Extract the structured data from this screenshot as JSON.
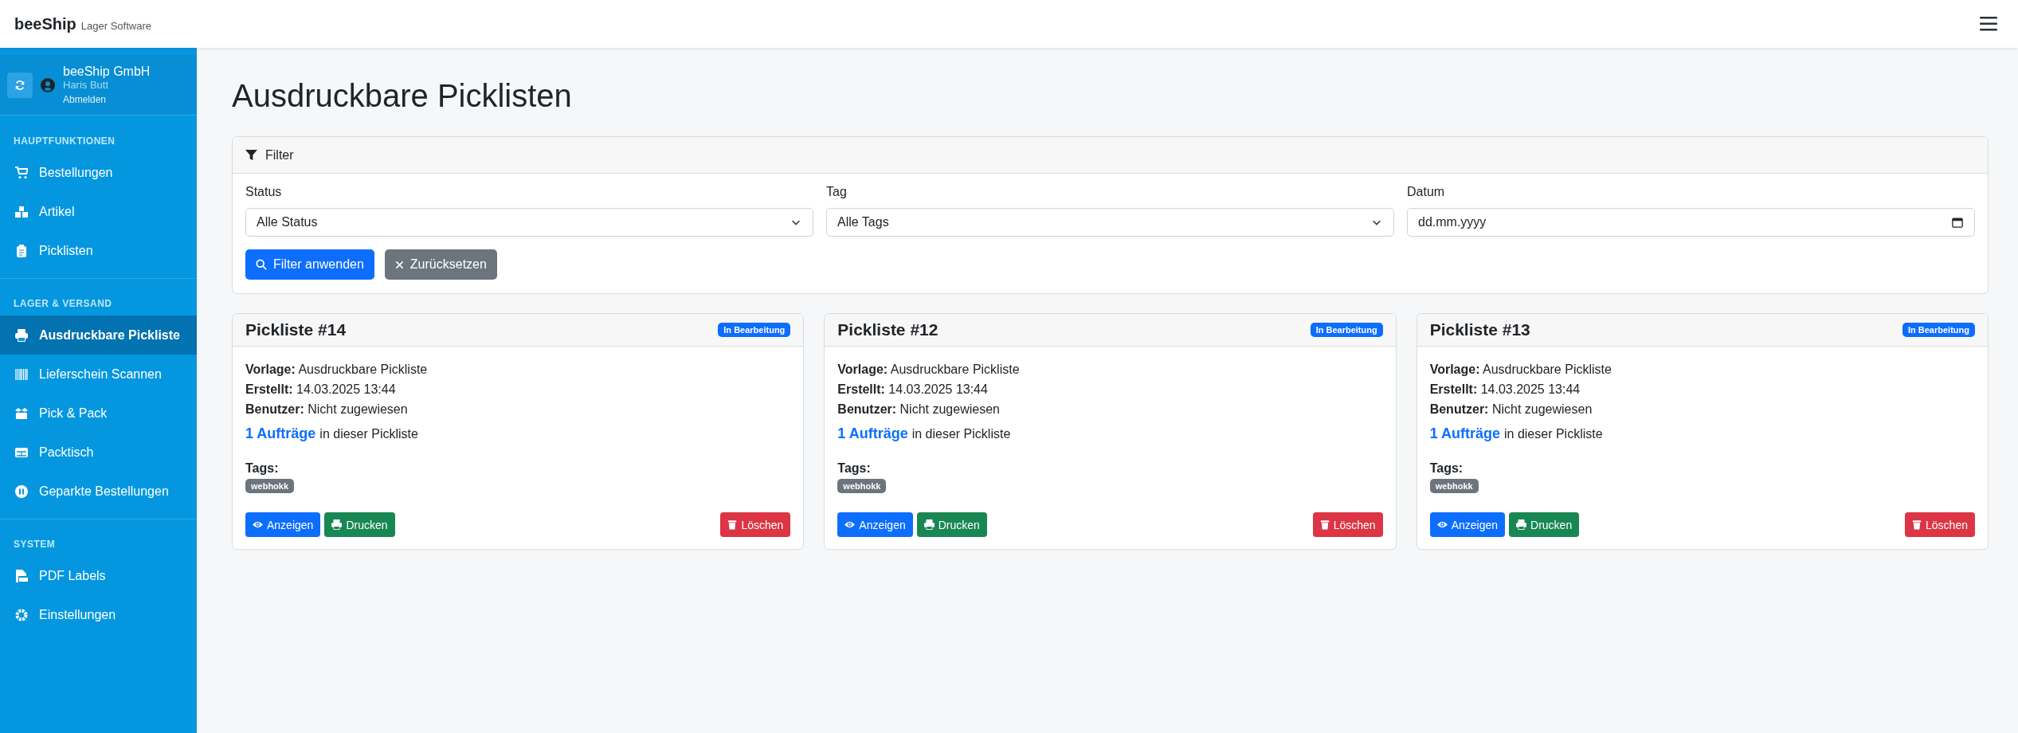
{
  "brand": {
    "name": "beeShip",
    "subtitle": "Lager Software"
  },
  "account": {
    "company": "beeShip GmbH",
    "user": "Haris Butt",
    "logout": "Abmelden"
  },
  "sidebar": {
    "sections": [
      {
        "title": "HAUPTFUNKTIONEN",
        "items": [
          {
            "label": "Bestellungen",
            "selected": false
          },
          {
            "label": "Artikel",
            "selected": false
          },
          {
            "label": "Picklisten",
            "selected": false
          }
        ]
      },
      {
        "title": "LAGER & VERSAND",
        "items": [
          {
            "label": "Ausdruckbare Pickliste",
            "selected": true
          },
          {
            "label": "Lieferschein Scannen",
            "selected": false
          },
          {
            "label": "Pick & Pack",
            "selected": false
          },
          {
            "label": "Packtisch",
            "selected": false
          },
          {
            "label": "Geparkte Bestellungen",
            "selected": false
          }
        ]
      },
      {
        "title": "SYSTEM",
        "items": [
          {
            "label": "PDF Labels",
            "selected": false
          },
          {
            "label": "Einstellungen",
            "selected": false
          }
        ]
      }
    ]
  },
  "page_title": "Ausdruckbare Picklisten",
  "filter": {
    "title": "Filter",
    "fields": [
      {
        "kind": "select",
        "label": "Status",
        "value": "Alle Status"
      },
      {
        "kind": "select",
        "label": "Tag",
        "value": "Alle Tags"
      },
      {
        "kind": "date",
        "label": "Datum",
        "placeholder": "dd.mm.yyyy"
      }
    ],
    "apply": "Filter anwenden",
    "reset": "Zurücksetzen"
  },
  "cards": [
    {
      "title": "Pickliste #14",
      "status": "In Bearbeitung",
      "details": [
        "**Vorlage:** Ausdruckbare Pickliste",
        "**Erstellt:** 14.03.2025 13:44",
        "**Benutzer:** Nicht zugewiesen"
      ],
      "orders_link": "1 Aufträge",
      "orders_text": "in dieser Pickliste",
      "tags_label": "Tags:",
      "tags": [
        "webhokk"
      ],
      "view": "Anzeigen",
      "print": "Drucken",
      "delete": "Löschen"
    },
    {
      "title": "Pickliste #12",
      "status": "In Bearbeitung",
      "details": [
        "**Vorlage:** Ausdruckbare Pickliste",
        "**Erstellt:** 14.03.2025 13:44",
        "**Benutzer:** Nicht zugewiesen"
      ],
      "orders_link": "1 Aufträge",
      "orders_text": "in dieser Pickliste",
      "tags_label": "Tags:",
      "tags": [
        "webhokk"
      ],
      "view": "Anzeigen",
      "print": "Drucken",
      "delete": "Löschen"
    },
    {
      "title": "Pickliste #13",
      "status": "In Bearbeitung",
      "details": [
        "**Vorlage:** Ausdruckbare Pickliste",
        "**Erstellt:** 14.03.2025 13:44",
        "**Benutzer:** Nicht zugewiesen"
      ],
      "orders_link": "1 Aufträge",
      "orders_text": "in dieser Pickliste",
      "tags_label": "Tags:",
      "tags": [
        "webhokk"
      ],
      "view": "Anzeigen",
      "print": "Drucken",
      "delete": "Löschen"
    }
  ]
}
